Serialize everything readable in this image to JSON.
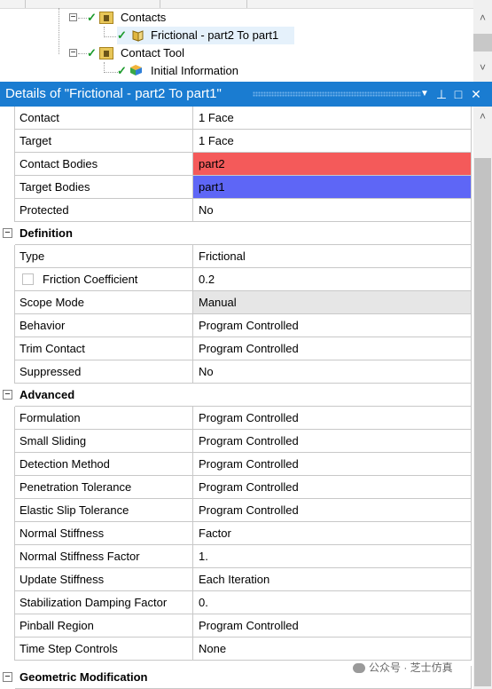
{
  "tree": {
    "items": [
      {
        "label": "Contacts"
      },
      {
        "label": "Frictional - part2 To part1"
      },
      {
        "label": "Contact Tool"
      },
      {
        "label": "Initial Information"
      }
    ]
  },
  "details": {
    "title": "Details of \"Frictional - part2 To part1\"",
    "controls": {
      "dropdown": "▼",
      "pin": "⊥",
      "maximize": "□",
      "close": "✕"
    }
  },
  "rows": {
    "contact": {
      "name": "Contact",
      "value": "1 Face"
    },
    "target": {
      "name": "Target",
      "value": "1 Face"
    },
    "contact_bodies": {
      "name": "Contact Bodies",
      "value": "part2"
    },
    "target_bodies": {
      "name": "Target Bodies",
      "value": "part1"
    },
    "protected": {
      "name": "Protected",
      "value": "No"
    },
    "definition_group": "Definition",
    "type": {
      "name": "Type",
      "value": "Frictional"
    },
    "friction_coefficient": {
      "name": "Friction Coefficient",
      "value": "0.2"
    },
    "scope_mode": {
      "name": "Scope Mode",
      "value": "Manual"
    },
    "behavior": {
      "name": "Behavior",
      "value": "Program Controlled"
    },
    "trim_contact": {
      "name": "Trim Contact",
      "value": "Program Controlled"
    },
    "suppressed": {
      "name": "Suppressed",
      "value": "No"
    },
    "advanced_group": "Advanced",
    "formulation": {
      "name": "Formulation",
      "value": "Program Controlled"
    },
    "small_sliding": {
      "name": "Small Sliding",
      "value": "Program Controlled"
    },
    "detection_method": {
      "name": "Detection Method",
      "value": "Program Controlled"
    },
    "penetration_tolerance": {
      "name": "Penetration Tolerance",
      "value": "Program Controlled"
    },
    "elastic_slip_tolerance": {
      "name": "Elastic Slip Tolerance",
      "value": "Program Controlled"
    },
    "normal_stiffness": {
      "name": "Normal Stiffness",
      "value": "Factor"
    },
    "normal_stiffness_factor": {
      "name": "Normal Stiffness Factor",
      "value": "1."
    },
    "update_stiffness": {
      "name": "Update Stiffness",
      "value": "Each Iteration"
    },
    "stabilization_damping_factor": {
      "name": "Stabilization Damping Factor",
      "value": "0."
    },
    "pinball_region": {
      "name": "Pinball Region",
      "value": "Program Controlled"
    },
    "time_step_controls": {
      "name": "Time Step Controls",
      "value": "None"
    },
    "geometric_modification_group": "Geometric Modification"
  },
  "colors": {
    "contact_bodies": "#f45a5a",
    "target_bodies": "#5e66f6",
    "header": "#1a7cd1"
  },
  "watermark": "公众号 · 芝士仿真"
}
